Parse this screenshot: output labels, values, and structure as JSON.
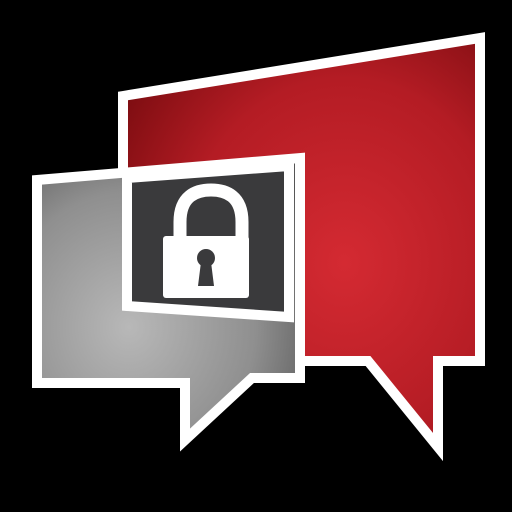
{
  "icon": {
    "name": "secure-chat-app-icon",
    "elements": [
      "red-speech-bubble-icon",
      "gray-speech-bubble-icon",
      "padlock-icon"
    ]
  },
  "colors": {
    "background": "#000000",
    "outline": "#ffffff",
    "red_light": "#d42a32",
    "red_dark": "#7a0c10",
    "gray_light": "#b8b8b8",
    "gray_dark": "#555555",
    "lock_panel": "#3a3a3c",
    "lock_body": "#ffffff",
    "keyhole": "#3a3a3c"
  }
}
